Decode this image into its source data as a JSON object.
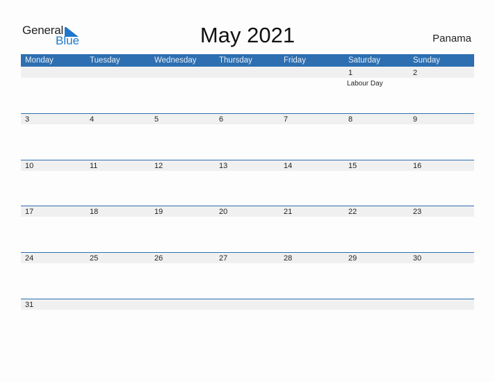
{
  "logo": {
    "text_general": "General",
    "text_blue": "Blue"
  },
  "title": "May 2021",
  "country": "Panama",
  "weekdays": [
    "Monday",
    "Tuesday",
    "Wednesday",
    "Thursday",
    "Friday",
    "Saturday",
    "Sunday"
  ],
  "colors": {
    "accent": "#2d6fb0",
    "band": "#f0f0f0"
  },
  "weeks": [
    [
      {
        "day": ""
      },
      {
        "day": ""
      },
      {
        "day": ""
      },
      {
        "day": ""
      },
      {
        "day": ""
      },
      {
        "day": "1",
        "event": "Labour Day"
      },
      {
        "day": "2"
      }
    ],
    [
      {
        "day": "3"
      },
      {
        "day": "4"
      },
      {
        "day": "5"
      },
      {
        "day": "6"
      },
      {
        "day": "7"
      },
      {
        "day": "8"
      },
      {
        "day": "9"
      }
    ],
    [
      {
        "day": "10"
      },
      {
        "day": "11"
      },
      {
        "day": "12"
      },
      {
        "day": "13"
      },
      {
        "day": "14"
      },
      {
        "day": "15"
      },
      {
        "day": "16"
      }
    ],
    [
      {
        "day": "17"
      },
      {
        "day": "18"
      },
      {
        "day": "19"
      },
      {
        "day": "20"
      },
      {
        "day": "21"
      },
      {
        "day": "22"
      },
      {
        "day": "23"
      }
    ],
    [
      {
        "day": "24"
      },
      {
        "day": "25"
      },
      {
        "day": "26"
      },
      {
        "day": "27"
      },
      {
        "day": "28"
      },
      {
        "day": "29"
      },
      {
        "day": "30"
      }
    ],
    [
      {
        "day": "31"
      },
      {
        "day": ""
      },
      {
        "day": ""
      },
      {
        "day": ""
      },
      {
        "day": ""
      },
      {
        "day": ""
      },
      {
        "day": ""
      }
    ]
  ]
}
